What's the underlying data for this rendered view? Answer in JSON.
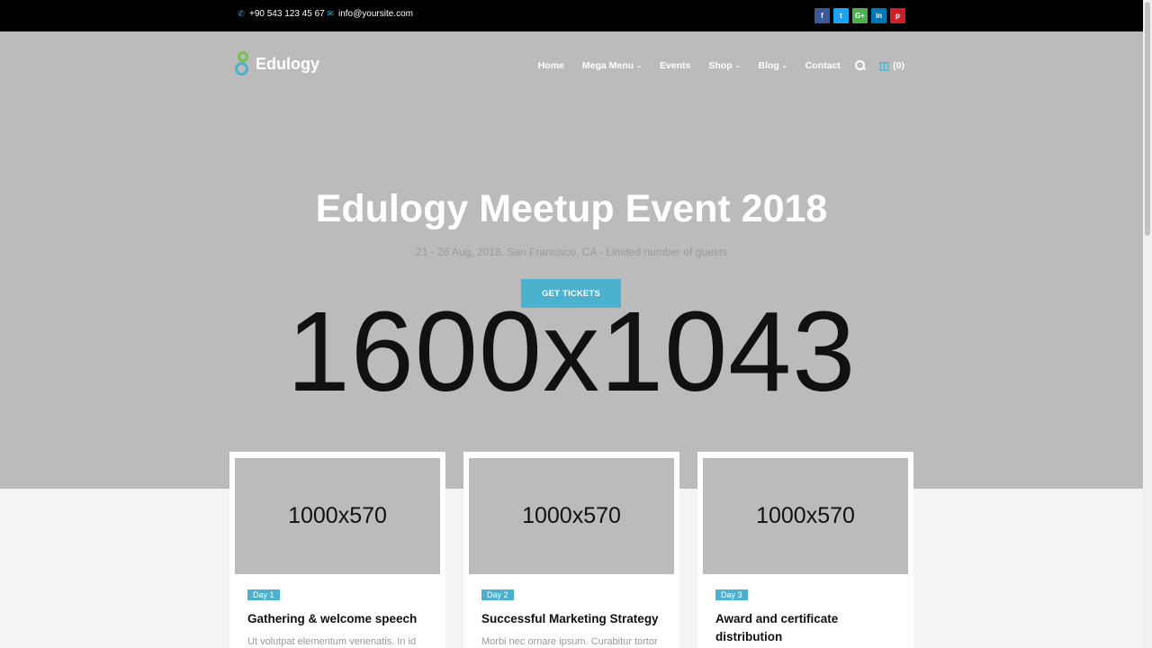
{
  "topbar": {
    "phone": "+90 543 123 45 67",
    "email": "info@yoursite.com",
    "social": [
      {
        "icon": "facebook-icon",
        "glyph": "f",
        "color": "#3b5998"
      },
      {
        "icon": "twitter-icon",
        "glyph": "t",
        "color": "#1da1f2"
      },
      {
        "icon": "google-plus-icon",
        "glyph": "G+",
        "color": "#4caf50"
      },
      {
        "icon": "linkedin-icon",
        "glyph": "in",
        "color": "#0077b5"
      },
      {
        "icon": "pinterest-icon",
        "glyph": "p",
        "color": "#cb2027"
      }
    ]
  },
  "brand": {
    "name": "Edulogy"
  },
  "nav": {
    "items": [
      "Home",
      "Mega Menu",
      "Events",
      "Shop",
      "Blog",
      "Contact"
    ],
    "cart_count": "(0)"
  },
  "hero": {
    "title": "Edulogy Meetup Event 2018",
    "subtitle": "21 - 26 Aug, 2018, San Francisco, CA - Limited number of guests",
    "cta": "GET TICKETS",
    "placeholder": "1600x1043"
  },
  "cards": [
    {
      "placeholder": "1000x570",
      "badge": "Day 1",
      "title": "Gathering & welcome speech",
      "excerpt": "Ut volutpat elementum venenatis. In id"
    },
    {
      "placeholder": "1000x570",
      "badge": "Day 2",
      "title": "Successful Marketing Strategy",
      "excerpt": "Morbi nec ornare ipsum. Curabitur tortor"
    },
    {
      "placeholder": "1000x570",
      "badge": "Day 3",
      "title": "Award and certificate distribution",
      "excerpt": ""
    }
  ],
  "colors": {
    "accent": "#4cb0cf",
    "topbar": "#000000",
    "hero_bg": "#bbbbbb"
  }
}
